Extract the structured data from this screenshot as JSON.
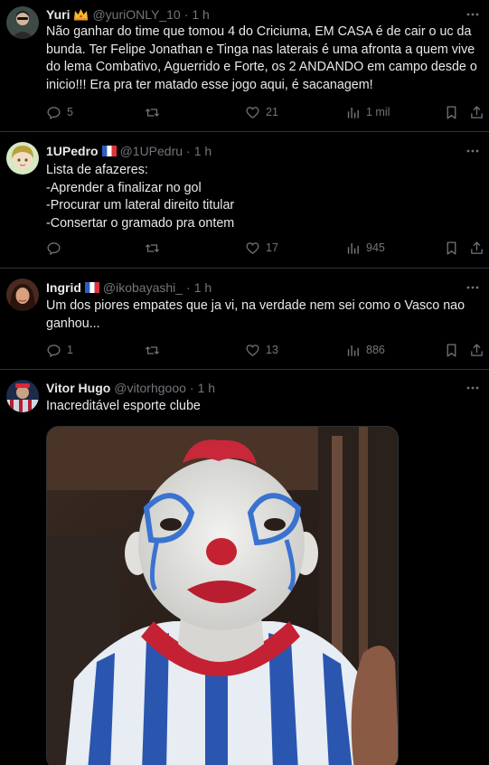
{
  "tweets": [
    {
      "name": "Yuri",
      "badge": "crown-emoji",
      "handle": "@yuriONLY_10",
      "dot": "·",
      "time": "1 h",
      "text_lines": [
        "Não ganhar do time que tomou 4 do Criciuma, EM CASA é de cair o uc da",
        "bunda. Ter Felipe Jonathan e Tinga nas laterais é uma afronta a quem vive",
        "do lema Combativo, Aguerrido e Forte, os 2 ANDANDO em campo desde o",
        "inicio!!! Era pra ter matado esse jogo aqui, é sacanagem!"
      ],
      "replies": "5",
      "reposts": "",
      "likes": "21",
      "views": "1 mil"
    },
    {
      "name": "1UPedro",
      "badge": "france-flag",
      "handle": "@1UPedru",
      "dot": "·",
      "time": "1 h",
      "text_lines": [
        "Lista de afazeres:",
        "-Aprender a finalizar no gol",
        "-Procurar um lateral direito titular",
        "-Consertar o gramado pra ontem"
      ],
      "replies": "",
      "reposts": "",
      "likes": "17",
      "views": "945"
    },
    {
      "name": "Ingrid",
      "badge": "france-flag",
      "handle": "@ikobayashi_",
      "dot": "·",
      "time": "1 h",
      "text_lines": [
        "Um dos piores empates que ja vi, na verdade nem sei como o Vasco nao",
        "ganhou..."
      ],
      "replies": "1",
      "reposts": "",
      "likes": "13",
      "views": "886"
    },
    {
      "name": "Vitor Hugo",
      "badge": "",
      "handle": "@vitorhgooo",
      "dot": "·",
      "time": "1 h",
      "text_lines": [
        "Inacreditável esporte clube"
      ]
    }
  ],
  "colors": {
    "background": "#000000",
    "text": "#e7e9ea",
    "muted": "#71767b",
    "divider": "#2f3336"
  }
}
